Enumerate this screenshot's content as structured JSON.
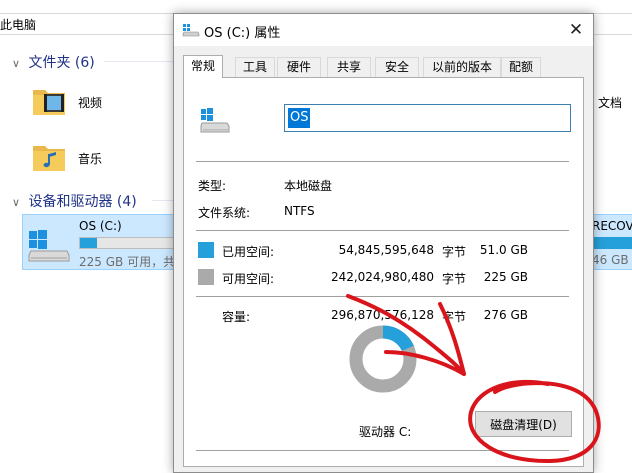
{
  "explorer": {
    "address_text": "此电脑",
    "folders_header": "文件夹 (6)",
    "folders": [
      {
        "label": "视频",
        "icon": "video-folder-icon"
      },
      {
        "label": "音乐",
        "icon": "music-folder-icon"
      }
    ],
    "devices_header": "设备和驱动器 (4)",
    "drive": {
      "name": "OS (C:)",
      "free_text": "225 GB 可用，共",
      "used_fraction": 0.18
    },
    "right_doc_label": "文档",
    "right_drive_name": "RECOVE",
    "right_drive_free": "46 GB"
  },
  "dialog": {
    "title": "OS (C:) 属性",
    "close_glyph": "✕",
    "tabs": [
      "常规",
      "工具",
      "硬件",
      "共享",
      "安全",
      "以前的版本",
      "配额"
    ],
    "active_tab": 0,
    "volume_name": "OS",
    "type_label": "类型:",
    "type_value": "本地磁盘",
    "fs_label": "文件系统:",
    "fs_value": "NTFS",
    "used": {
      "label": "已用空间:",
      "bytes": "54,845,595,648",
      "unit": "字节",
      "human": "51.0 GB",
      "color": "#26a0da"
    },
    "free": {
      "label": "可用空间:",
      "bytes": "242,024,980,480",
      "unit": "字节",
      "human": "225 GB",
      "color": "#aaaaaa"
    },
    "capacity": {
      "label": "容量:",
      "bytes": "296,870,576,128",
      "unit": "字节",
      "human": "276 GB"
    },
    "used_fraction": 0.185,
    "drive_caption": "驱动器 C:",
    "cleanup_button": "磁盘清理(D)"
  },
  "colors": {
    "accent": "#0078d7",
    "used": "#26a0da",
    "free": "#aaaaaa",
    "annotation": "#d9141b"
  }
}
